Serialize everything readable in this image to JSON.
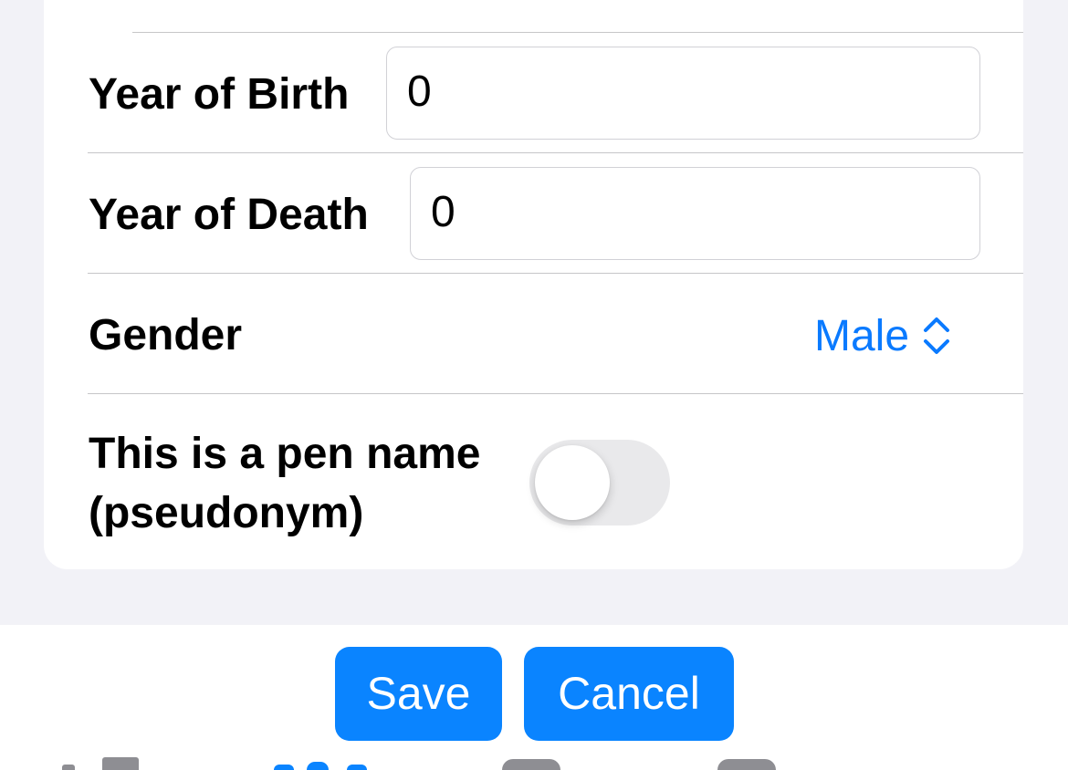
{
  "form": {
    "year_of_birth": {
      "label": "Year of Birth",
      "value": "0"
    },
    "year_of_death": {
      "label": "Year of Death",
      "value": "0"
    },
    "gender": {
      "label": "Gender",
      "value": "Male"
    },
    "pen_name": {
      "label_line1": "This is a pen name",
      "label_line2": "(pseudonym)",
      "checked": false
    }
  },
  "actions": {
    "save_label": "Save",
    "cancel_label": "Cancel"
  },
  "colors": {
    "accent": "#0a84ff",
    "background": "#f2f2f7",
    "card": "#ffffff",
    "toggle_off": "#e9e9eb"
  },
  "icons": {
    "gender_picker": "chevron-up-down-icon"
  }
}
